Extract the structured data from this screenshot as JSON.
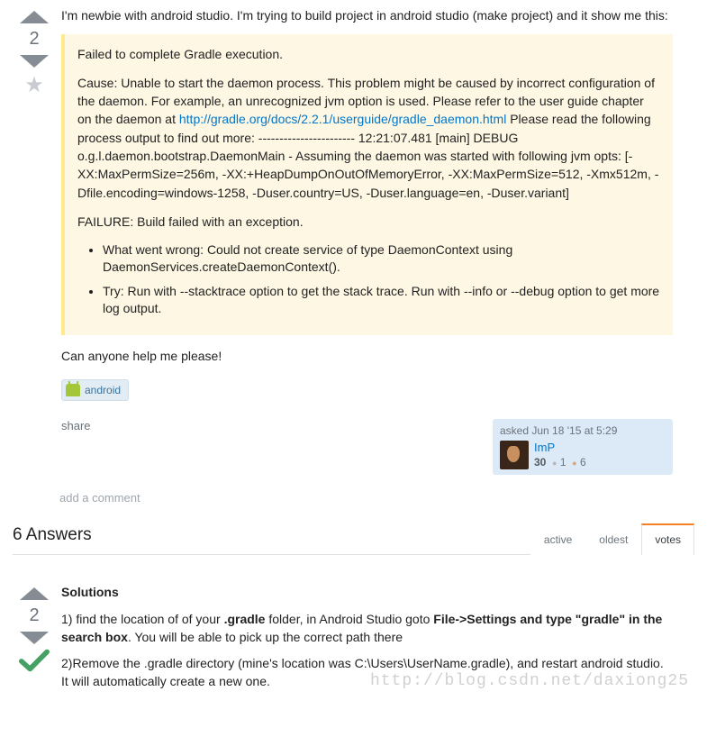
{
  "question": {
    "score": "2",
    "intro": "I'm newbie with android studio. I'm trying to build project in android studio (make project) and it show me this:",
    "quote_p1": "Failed to complete Gradle execution.",
    "quote_p2_pre": "Cause: Unable to start the daemon process. This problem might be caused by incorrect configuration of the daemon. For example, an unrecognized jvm option is used. Please refer to the user guide chapter on the daemon at ",
    "quote_link": "http://gradle.org/docs/2.2.1/userguide/gradle_daemon.html",
    "quote_p2_post": " Please read the following process output to find out more: ----------------------- 12:21:07.481 [main] DEBUG o.g.l.daemon.bootstrap.DaemonMain - Assuming the daemon was started with following jvm opts: [-XX:MaxPermSize=256m, -XX:+HeapDumpOnOutOfMemoryError, -XX:MaxPermSize=512, -Xmx512m, -Dfile.encoding=windows-1258, -Duser.country=US, -Duser.language=en, -Duser.variant]",
    "quote_p3": "FAILURE: Build failed with an exception.",
    "quote_li1": "What went wrong: Could not create service of type DaemonContext using DaemonServices.createDaemonContext().",
    "quote_li2": "Try: Run with --stacktrace option to get the stack trace. Run with --info or --debug option to get more log output.",
    "outro": "Can anyone help me please!",
    "tag": "android",
    "share": "share",
    "asked_prefix": "asked ",
    "asked_time": "Jun 18 '15 at 5:29",
    "user_name": "ImP",
    "user_rep": "30",
    "badge_silver": "1",
    "badge_bronze": "6",
    "add_comment": "add a comment"
  },
  "answers_section": {
    "header": "6 Answers",
    "tabs": {
      "active": "active",
      "oldest": "oldest",
      "votes": "votes"
    }
  },
  "answer": {
    "score": "2",
    "h": "Solutions",
    "p1_a": "1) find the location of of your ",
    "p1_b": ".gradle",
    "p1_c": " folder, in Android Studio goto ",
    "p1_d": "File->Settings and type \"gradle\" in the search box",
    "p1_e": ". You will be able to pick up the correct path there",
    "p2": "2)Remove the .gradle directory (mine's location was C:\\Users\\UserName.gradle), and restart android studio. It will automatically create a new one."
  },
  "watermark": "http://blog.csdn.net/daxiong25"
}
